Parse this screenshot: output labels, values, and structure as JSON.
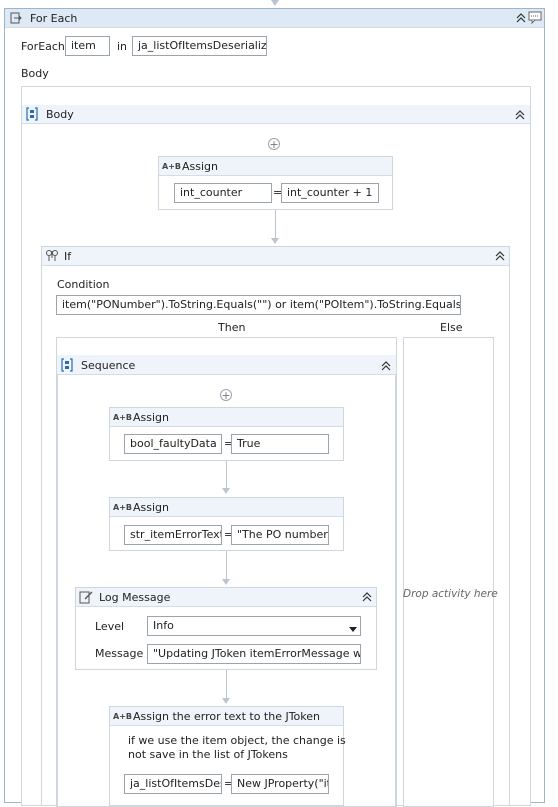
{
  "foreach": {
    "title": "For Each",
    "foreach_label": "ForEach",
    "item_value": "item",
    "in_label": "in",
    "collection_value": "ja_listOfItemsDeserialized",
    "body_label": "Body"
  },
  "body_seq": {
    "title": "Body",
    "assign1": {
      "title": "Assign",
      "to": "int_counter",
      "value": "int_counter + 1"
    }
  },
  "if_block": {
    "title": "If",
    "condition_label": "Condition",
    "condition_value": "item(\"PONumber\").ToString.Equals(\"\") or item(\"POItem\").ToString.Equals(\"\")",
    "then_label": "Then",
    "else_label": "Else",
    "else_placeholder": "Drop activity here"
  },
  "sequence": {
    "title": "Sequence",
    "assign_a": {
      "title": "Assign",
      "to": "bool_faultyData",
      "value": "True"
    },
    "assign_b": {
      "title": "Assign",
      "to": "str_itemErrorText",
      "value": "\"The PO number a"
    },
    "log": {
      "title": "Log Message",
      "level_label": "Level",
      "level_value": "Info",
      "message_label": "Message",
      "message_value": "\"Updating JToken itemErrorMessage with :"
    },
    "assign_c": {
      "title": "Assign the error text to the JToken",
      "comment_line1": "if we use the item object, the change is",
      "comment_line2": "not save in the list of JTokens",
      "to": "ja_listOfItemsDese",
      "value": "New JProperty(\"ite"
    }
  },
  "common": {
    "equals": "=",
    "ab_icon": "A+B",
    "plus": "+",
    "collapse": "«"
  }
}
